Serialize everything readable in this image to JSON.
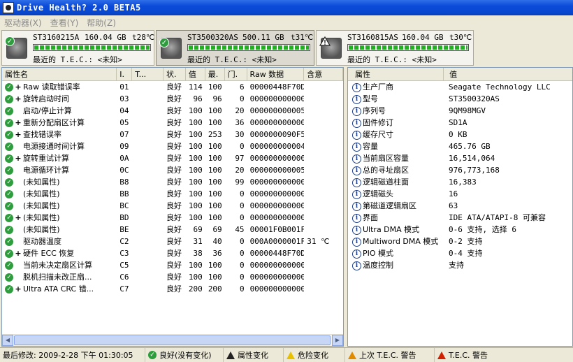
{
  "window": {
    "title": "Drive Health? 2.0 BETA5"
  },
  "menu": [
    {
      "label": "驱动器(X)"
    },
    {
      "label": "查看(Y)"
    },
    {
      "label": "帮助(Z)"
    }
  ],
  "drives": [
    {
      "model": "ST3160215A",
      "capacity": "160.04 GB",
      "temp": "t28℃",
      "tec": "最近的 T.E.C.: <未知>",
      "health": 1.0,
      "status": "ok",
      "selected": false
    },
    {
      "model": "ST3500320AS",
      "capacity": "500.11 GB",
      "temp": "t31℃",
      "tec": "最近的 T.E.C.: <未知>",
      "health": 1.0,
      "status": "ok",
      "selected": true
    },
    {
      "model": "ST3160815AS",
      "capacity": "160.04 GB",
      "temp": "t30℃",
      "tec": "最近的 T.E.C.: <未知>",
      "health": 1.0,
      "status": "warn",
      "selected": false
    }
  ],
  "smart": {
    "columns": [
      "属性名",
      "I.",
      "T...",
      "状.",
      "值",
      "最.",
      "门.",
      "Raw 数据",
      "含意"
    ],
    "rows": [
      {
        "plus": "+",
        "name": "Raw 读取错误率",
        "id": "01",
        "t": "",
        "state": "良好",
        "value": "114",
        "worst": "100",
        "thresh": "6",
        "raw": "00000448F70D",
        "meaning": ""
      },
      {
        "plus": "+",
        "name": "旋转启动时间",
        "id": "03",
        "t": "",
        "state": "良好",
        "value": "96",
        "worst": "96",
        "thresh": "0",
        "raw": "000000000000",
        "meaning": ""
      },
      {
        "plus": "",
        "name": "启动/停止计算",
        "id": "04",
        "t": "",
        "state": "良好",
        "value": "100",
        "worst": "100",
        "thresh": "20",
        "raw": "000000000005",
        "meaning": ""
      },
      {
        "plus": "+",
        "name": "重新分配扇区计算",
        "id": "05",
        "t": "",
        "state": "良好",
        "value": "100",
        "worst": "100",
        "thresh": "36",
        "raw": "000000000000",
        "meaning": ""
      },
      {
        "plus": "+",
        "name": "查找错误率",
        "id": "07",
        "t": "",
        "state": "良好",
        "value": "100",
        "worst": "253",
        "thresh": "30",
        "raw": "0000000090F5",
        "meaning": ""
      },
      {
        "plus": "",
        "name": "电源接通时间计算",
        "id": "09",
        "t": "",
        "state": "良好",
        "value": "100",
        "worst": "100",
        "thresh": "0",
        "raw": "000000000004",
        "meaning": ""
      },
      {
        "plus": "+",
        "name": "旋转重试计算",
        "id": "0A",
        "t": "",
        "state": "良好",
        "value": "100",
        "worst": "100",
        "thresh": "97",
        "raw": "000000000000",
        "meaning": ""
      },
      {
        "plus": "",
        "name": "电源循环计算",
        "id": "0C",
        "t": "",
        "state": "良好",
        "value": "100",
        "worst": "100",
        "thresh": "20",
        "raw": "000000000005",
        "meaning": ""
      },
      {
        "plus": "",
        "name": "(未知属性)",
        "id": "B8",
        "t": "",
        "state": "良好",
        "value": "100",
        "worst": "100",
        "thresh": "99",
        "raw": "000000000000",
        "meaning": ""
      },
      {
        "plus": "",
        "name": "(未知属性)",
        "id": "BB",
        "t": "",
        "state": "良好",
        "value": "100",
        "worst": "100",
        "thresh": "0",
        "raw": "000000000000",
        "meaning": ""
      },
      {
        "plus": "",
        "name": "(未知属性)",
        "id": "BC",
        "t": "",
        "state": "良好",
        "value": "100",
        "worst": "100",
        "thresh": "0",
        "raw": "000000000000",
        "meaning": ""
      },
      {
        "plus": "+",
        "name": "(未知属性)",
        "id": "BD",
        "t": "",
        "state": "良好",
        "value": "100",
        "worst": "100",
        "thresh": "0",
        "raw": "000000000000",
        "meaning": ""
      },
      {
        "plus": "",
        "name": "(未知属性)",
        "id": "BE",
        "t": "",
        "state": "良好",
        "value": "69",
        "worst": "69",
        "thresh": "45",
        "raw": "00001F0B001F",
        "meaning": ""
      },
      {
        "plus": "",
        "name": "驱动器温度",
        "id": "C2",
        "t": "",
        "state": "良好",
        "value": "31",
        "worst": "40",
        "thresh": "0",
        "raw": "000A0000001F",
        "meaning": "31 ℃"
      },
      {
        "plus": "+",
        "name": "硬件 ECC 恢复",
        "id": "C3",
        "t": "",
        "state": "良好",
        "value": "38",
        "worst": "36",
        "thresh": "0",
        "raw": "00000448F70D",
        "meaning": ""
      },
      {
        "plus": "",
        "name": "当前未决定扇区计算",
        "id": "C5",
        "t": "",
        "state": "良好",
        "value": "100",
        "worst": "100",
        "thresh": "0",
        "raw": "000000000000",
        "meaning": ""
      },
      {
        "plus": "",
        "name": "脱机扫描未改正扇...",
        "id": "C6",
        "t": "",
        "state": "良好",
        "value": "100",
        "worst": "100",
        "thresh": "0",
        "raw": "000000000000",
        "meaning": ""
      },
      {
        "plus": "+",
        "name": "Ultra ATA CRC 错...",
        "id": "C7",
        "t": "",
        "state": "良好",
        "value": "200",
        "worst": "200",
        "thresh": "0",
        "raw": "000000000000",
        "meaning": ""
      }
    ]
  },
  "props": {
    "columns": [
      "属性",
      "值"
    ],
    "rows": [
      {
        "name": "生产厂商",
        "value": "Seagate Technology LLC"
      },
      {
        "name": "型号",
        "value": "ST3500320AS"
      },
      {
        "name": "序列号",
        "value": "9QM98MGV"
      },
      {
        "name": "固件修订",
        "value": "SD1A"
      },
      {
        "name": "缓存尺寸",
        "value": "0 KB"
      },
      {
        "name": "容量",
        "value": "465.76 GB"
      },
      {
        "name": "当前扇区容量",
        "value": "16,514,064"
      },
      {
        "name": "总的寻址扇区",
        "value": "976,773,168"
      },
      {
        "name": "逻辑磁道柱面",
        "value": "16,383"
      },
      {
        "name": "逻辑磁头",
        "value": "16"
      },
      {
        "name": "第磁道逻辑扇区",
        "value": "63"
      },
      {
        "name": "界面",
        "value": "IDE ATA/ATAPI-8 可兼容"
      },
      {
        "name": "Ultra DMA 模式",
        "value": "0-6 支持, 选择 6"
      },
      {
        "name": "Multiword DMA 模式",
        "value": "0-2 支持"
      },
      {
        "name": "PIO 模式",
        "value": "0-4 支持"
      },
      {
        "name": "温度控制",
        "value": "支持"
      }
    ]
  },
  "status": {
    "last_modified": "最后修改: 2009-2-28 下午 01:30:05",
    "good": "良好(没有变化)",
    "attr_change": "属性变化",
    "danger_change": "危险变化",
    "last_tec": "上次 T.E.C. 警告",
    "tec_warning": "T.E.C. 警告"
  }
}
